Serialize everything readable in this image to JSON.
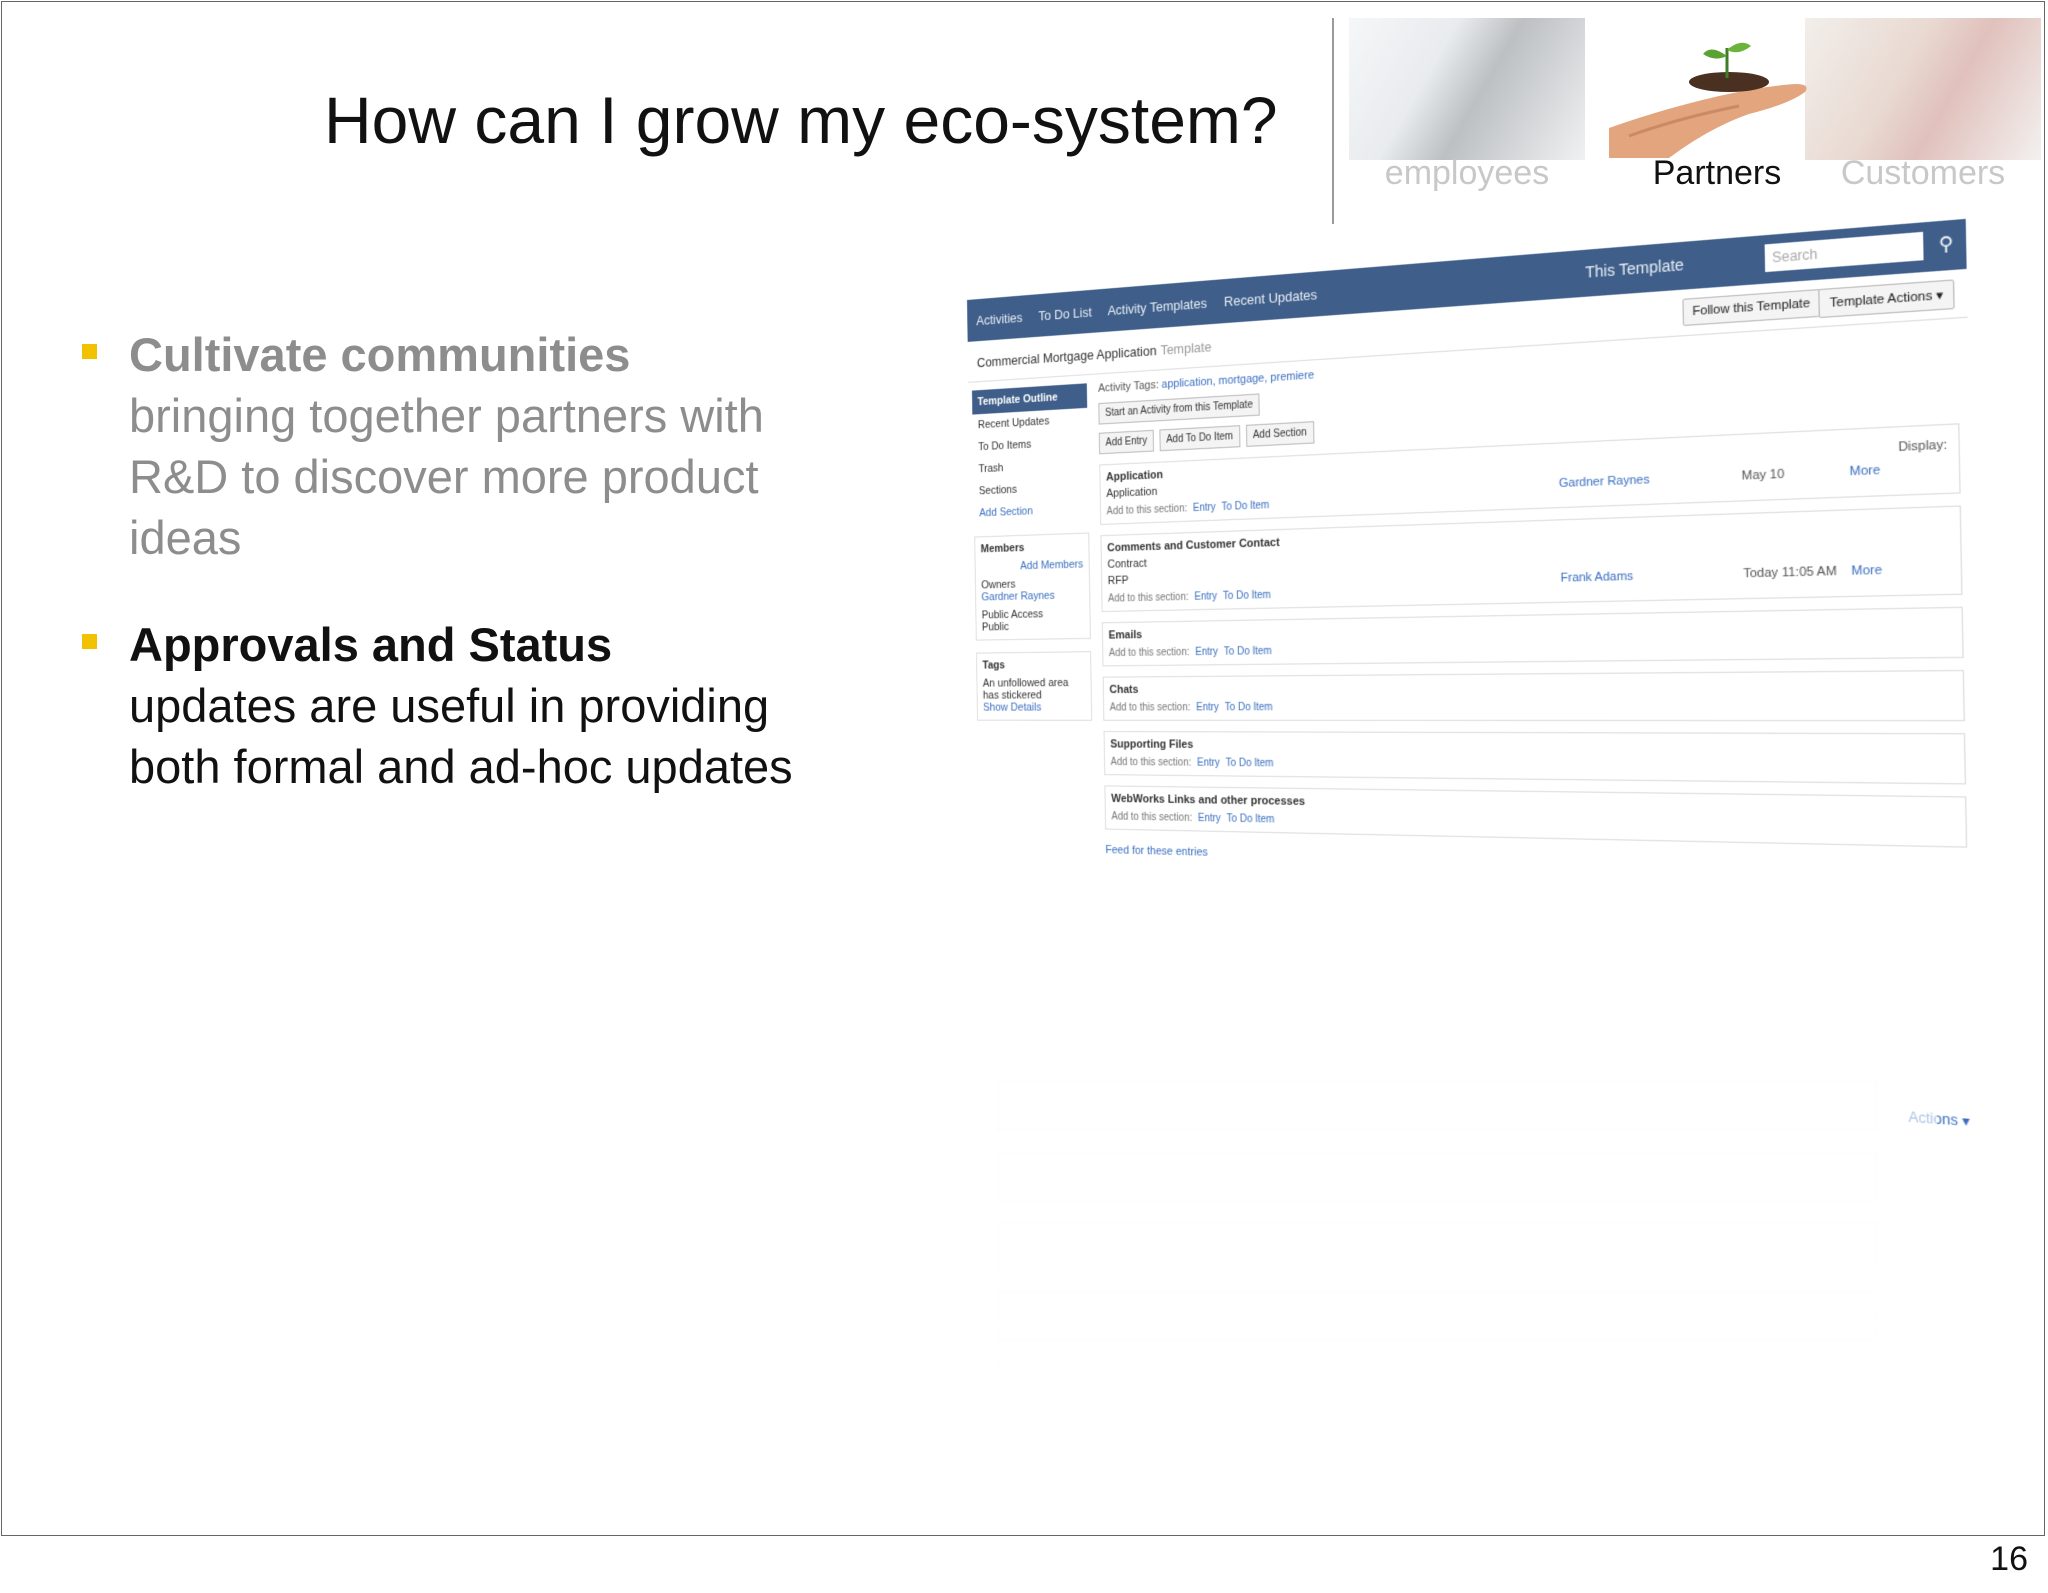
{
  "slide": {
    "title": "How can I grow my eco-system?",
    "page_number": "16"
  },
  "tabs": [
    {
      "label": "employees",
      "state": "dimmed"
    },
    {
      "label": "Partners",
      "state": "active"
    },
    {
      "label": "Customers",
      "state": "dimmed"
    }
  ],
  "bullets": [
    {
      "heading": "Cultivate communities",
      "body": "bringing together partners with R&D to discover more product ideas"
    },
    {
      "heading": "Approvals and Status",
      "body": "updates are useful in providing both formal and ad-hoc updates"
    }
  ],
  "colors": {
    "bullet_marker": "#f2c100",
    "app_header": "#3f5f8a"
  },
  "embedded_app": {
    "nav": [
      "Activities",
      "To Do List",
      "Activity Templates",
      "Recent Updates"
    ],
    "template_selector": "This Template",
    "search_placeholder": "Search",
    "app_title": "Commercial Mortgage Application",
    "app_subtitle": "Template",
    "follow_button": "Follow this Template",
    "actions_button": "Template Actions ▾",
    "sidebar": {
      "outline": "Template Outline",
      "items": [
        "Recent Updates",
        "To Do Items",
        "Trash",
        "Sections"
      ],
      "add_section": "Add Section",
      "members_title": "Members",
      "add_members": "Add Members",
      "owners_label": "Owners",
      "owner_name": "Gardner Raynes",
      "public_access": "Public Access",
      "public_value": "Public",
      "tags_title": "Tags",
      "tags_text": "An unfollowed area has stickered",
      "show_details": "Show Details"
    },
    "main": {
      "tags_label": "Activity Tags:",
      "tags_value": "application, mortgage, premiere",
      "start_button": "Start an Activity from this Template",
      "buttons": [
        "Add Entry",
        "Add To Do Item",
        "Add Section"
      ],
      "display_label": "Display:",
      "add_label": "Add to this section:",
      "add_links": [
        "Entry",
        "To Do Item"
      ],
      "sections": [
        {
          "title": "Application",
          "entries": [
            "Application"
          ],
          "who": "Gardner Raynes",
          "when": "May 10",
          "more": "More"
        },
        {
          "title": "Comments and Customer Contact",
          "entries": [
            "Contract",
            "RFP"
          ],
          "who": "Frank Adams",
          "when": "Today 11:05 AM",
          "more": "More"
        },
        {
          "title": "Emails",
          "entries": [],
          "who": "",
          "when": "",
          "more": ""
        },
        {
          "title": "Chats",
          "entries": [],
          "who": "",
          "when": "",
          "more": ""
        },
        {
          "title": "Supporting Files",
          "entries": [],
          "who": "",
          "when": "",
          "more": ""
        },
        {
          "title": "WebWorks Links and other processes",
          "entries": [],
          "who": "",
          "when": "",
          "more": ""
        }
      ],
      "feed_link": "Feed for these entries",
      "actions": "Actions ▾"
    }
  }
}
